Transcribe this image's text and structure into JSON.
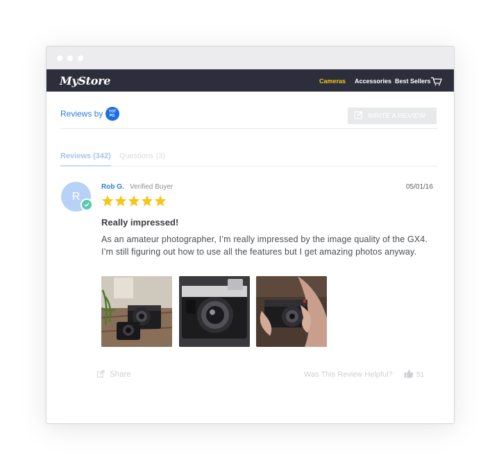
{
  "window": {
    "controls": [
      "dot",
      "dot",
      "dot"
    ]
  },
  "navbar": {
    "logo": "MyStore",
    "links": [
      {
        "label": "Cameras",
        "active": true
      },
      {
        "label": "Accessories",
        "active": false
      },
      {
        "label": "Best Sellers",
        "active": false
      }
    ],
    "cart_icon": "cart-icon"
  },
  "widget": {
    "reviews_by": "Reviews by",
    "provider_badge": "YOT PO.",
    "write_review_label": "WRITE A REVIEW",
    "write_review_icon": "edit-icon"
  },
  "tabs": {
    "reviews": "Reviews (342)",
    "questions": "Questions (3)"
  },
  "review": {
    "avatar_initial": "R",
    "author": "Rob G.",
    "badge": "Verified Buyer",
    "date": "05/01/16",
    "rating": 5,
    "title": "Really impressed!",
    "body": "As an amateur photographer, I’m really impressed by the image quality of the GX4. I’m still figuring out how to use all the features but I get amazing photos anyway.",
    "photos": [
      "camera-on-table-photo",
      "camera-closeup-photo",
      "camera-in-hands-photo"
    ],
    "share_label": "Share",
    "helpful_label": "Was This Review Helpful?",
    "helpful_count": "51"
  },
  "colors": {
    "accent": "#2e7bd7",
    "nav_active": "#f5c518",
    "navbar_bg": "#2c2f3b",
    "star": "#f5c518",
    "verified": "#5bc9ad"
  }
}
